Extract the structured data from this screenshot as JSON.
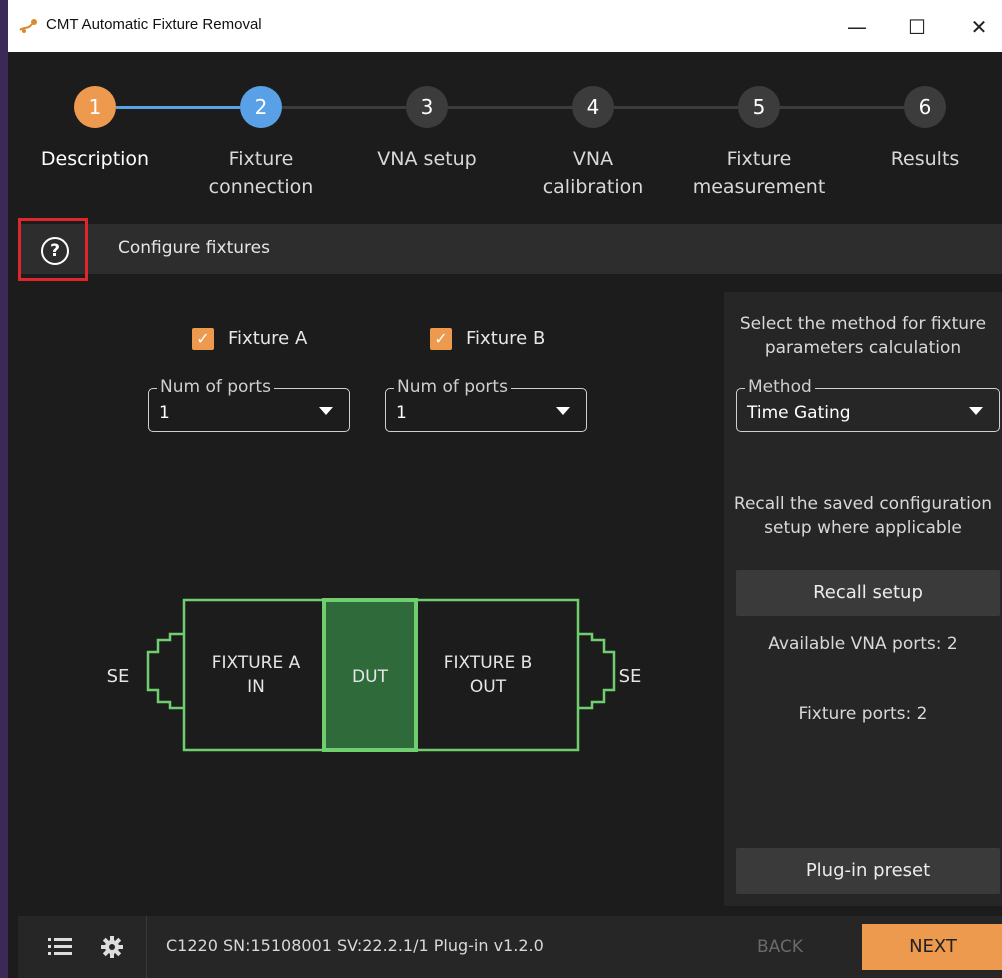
{
  "window": {
    "title": "CMT Automatic Fixture Removal",
    "min_glyph": "—",
    "max_glyph": "☐",
    "close_glyph": "✕"
  },
  "steps": [
    {
      "number": "1",
      "label": "Description",
      "state": "done"
    },
    {
      "number": "2",
      "label": "Fixture\nconnection",
      "state": "active"
    },
    {
      "number": "3",
      "label": "VNA setup",
      "state": "pending"
    },
    {
      "number": "4",
      "label": "VNA\ncalibration",
      "state": "pending"
    },
    {
      "number": "5",
      "label": "Fixture\nmeasurement",
      "state": "pending"
    },
    {
      "number": "6",
      "label": "Results",
      "state": "pending"
    }
  ],
  "header": {
    "help_glyph": "?",
    "title": "Configure fixtures"
  },
  "fixtures": {
    "a": {
      "label": "Fixture A",
      "checked": true,
      "ports_legend": "Num of ports",
      "ports_value": "1"
    },
    "b": {
      "label": "Fixture B",
      "checked": true,
      "ports_legend": "Num of ports",
      "ports_value": "1"
    },
    "check_glyph": "✓"
  },
  "diagram": {
    "left_port": "SE",
    "right_port": "SE",
    "fixture_a_line1": "FIXTURE A",
    "fixture_a_line2": "IN",
    "dut": "DUT",
    "fixture_b_line1": "FIXTURE B",
    "fixture_b_line2": "OUT"
  },
  "panel": {
    "method_prompt": "Select the method for fixture parameters calculation",
    "method_legend": "Method",
    "method_value": "Time Gating",
    "recall_prompt": "Recall the saved configuration setup where applicable",
    "recall_button": "Recall setup",
    "vna_ports": "Available VNA ports: 2",
    "fixture_ports": "Fixture ports: 2",
    "preset_button": "Plug-in preset"
  },
  "footer": {
    "menu_icon": "list-icon",
    "settings_icon": "gear-icon",
    "status": "C1220 SN:15108001 SV:22.2.1/1 Plug-in v1.2.0",
    "back": "BACK",
    "next": "NEXT"
  },
  "colors": {
    "accent_orange": "#ee9a4e",
    "active_blue": "#5aa0e6",
    "pending_gray": "#3c3c3c",
    "diagram_green": "#6fcf6f",
    "dut_fill": "#2f6b3a",
    "highlight_red": "#e0262d"
  }
}
